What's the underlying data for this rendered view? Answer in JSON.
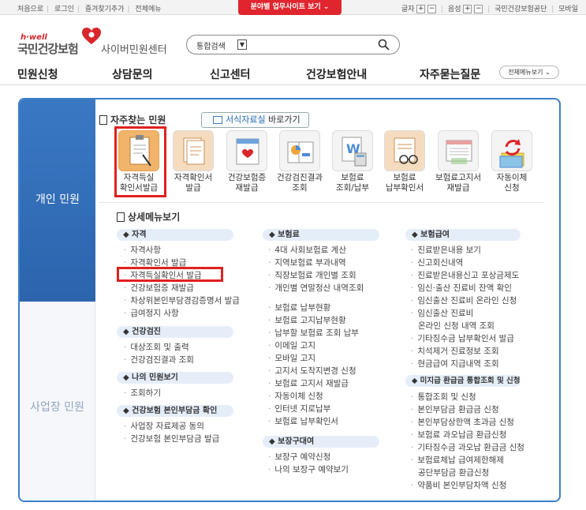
{
  "topbar": {
    "left": [
      "처음으로",
      "로그인",
      "즐겨찾기추가",
      "전체메뉴"
    ],
    "highlight": "분야별 업무사이트 보기",
    "font_label": "글자",
    "sound_label": "음성",
    "plus": "+",
    "minus": "−",
    "right": [
      "국민건강보험공단",
      "모바일"
    ]
  },
  "logo": {
    "hwell": "h·well",
    "name": "국민건강보험",
    "center": "사이버민원센터"
  },
  "search": {
    "category": "통합검색"
  },
  "nav": {
    "items": [
      "민원신청",
      "상담문의",
      "신고센터",
      "건강보험안내",
      "자주묻는질문"
    ],
    "all_menu": "전체메뉴보기"
  },
  "sidetabs": {
    "personal": "개인 민원",
    "business": "사업장 민원"
  },
  "frequent": {
    "title": "자주찾는 민원",
    "forms_a": "서식자료실",
    "forms_b": " 바로가기"
  },
  "quick": [
    {
      "l1": "자격득실",
      "l2": "확인서발급"
    },
    {
      "l1": "자격확인서",
      "l2": "발급"
    },
    {
      "l1": "건강보험증",
      "l2": "재발급"
    },
    {
      "l1": "건강검진결과",
      "l2": "조회"
    },
    {
      "l1": "보험료",
      "l2": "조회/납부"
    },
    {
      "l1": "보험료",
      "l2": "납부확인서"
    },
    {
      "l1": "보험료고지서",
      "l2": "재발급"
    },
    {
      "l1": "자동이체",
      "l2": "신청"
    }
  ],
  "detail": {
    "title": "상세메뉴보기"
  },
  "col1": {
    "s1": {
      "title": "자격",
      "items": [
        "자격사항",
        "자격확인서 발급",
        "자격득실확인서 발급",
        "건강보험증 재발급",
        "차상위본인부담경감증명서 발급",
        "급여정지 사항"
      ]
    },
    "s2": {
      "title": "건강검진",
      "items": [
        "대상조회 및 출력",
        "건강검진결과 조회"
      ]
    },
    "s3": {
      "title": "나의 민원보기",
      "items": [
        "조회하기"
      ]
    },
    "s4": {
      "title": "건강보험 본인부담금 확인",
      "items": [
        "사업장 자료제공 동의",
        "건강보험 본인부담금 발급"
      ]
    }
  },
  "col2": {
    "s1": {
      "title": "보험료",
      "items": [
        "4대 사회보험료 계산",
        "지역보험료 부과내역",
        "직장보험료 개인별 조회",
        "개인별 연말정산 내역조회",
        "보험료 납부현황",
        "보험료 고지납부현황",
        "납부할 보험료 조회 납부",
        "이메일 고지",
        "모바일 고지",
        "고지서 도착지변경 신청",
        "보험료 고지서 재발급",
        "자동이체 신청",
        "인터넷 지로납부",
        "보험료 납부확인서"
      ]
    },
    "s2": {
      "title": "보장구대여",
      "items": [
        "보장구 예약신청",
        "나의 보장구 예약보기"
      ]
    }
  },
  "col3": {
    "s1": {
      "title": "보험급여",
      "items": [
        "진료받은내용 보기",
        "신고회신내역",
        "진료받은내용신고 포상금제도",
        "임신·출산 진료비 잔액 확인",
        "임신출산 진료비 온라인 신청",
        "임신출산 진료비",
        "온라인 신청 내역 조회",
        "기타징수금 납부확인서 발급",
        "치석제거 진료정보 조회",
        "현금급여 지급내역 조회"
      ]
    },
    "s2": {
      "title": "미지급 환급금 통합조회 및 신청",
      "items": [
        "통합조회 및 신청",
        "본인부담금 환급금 신청",
        "본인부담상한액 초과금 신청",
        "보험료 과오납금 환급신청",
        "기타징수금 과오납 환급금 신청",
        "보험료체납 급여제한해제",
        "공단부담금 환급신청",
        "약품비 본인부담차액 신청"
      ]
    }
  },
  "colors": {
    "accent_blue": "#3d7fc6",
    "brand_red": "#e0252e",
    "highlight_box": "#e02020"
  }
}
